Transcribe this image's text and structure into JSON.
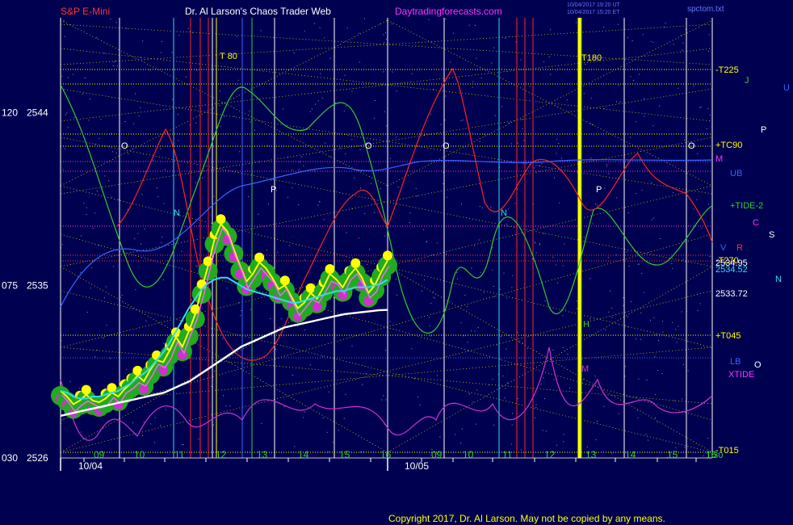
{
  "header": {
    "symbol": "S&P E-Mini",
    "title": "Dr. Al Larson's Chaos Trader Web",
    "site": "Daytradingforecasts.com",
    "timestamp1": "10/04/2017 19:20 UT",
    "timestamp2": "10/04/2017 15:20 ET",
    "file": "spctom.txt"
  },
  "footer": {
    "copyright": "Copyright 2017, Dr. Al Larson. May not be copied by any means."
  },
  "colors": {
    "background": "#000050",
    "grid": "#ffff00",
    "price": "#ffff00",
    "ma_cyan": "#33ddee",
    "ma_white": "#ffffff",
    "tide_green": "#33cc33",
    "red": "#ff2222",
    "magenta": "#cc33cc",
    "label_magenta": "#ff33ff",
    "label_red": "#ff3333"
  },
  "chart_data": {
    "type": "line",
    "ylim": [
      2526,
      2546
    ],
    "y_axis_labels": [
      {
        "left": "120",
        "value": "2544"
      },
      {
        "left": "075",
        "value": "2535"
      },
      {
        "left": "030",
        "value": "2526"
      }
    ],
    "x_hours": {
      "day1": [
        "09",
        "10",
        "11",
        "12",
        "13",
        "14",
        "15",
        "16"
      ],
      "day2": [
        "09",
        "10",
        "11",
        "12",
        "13",
        "14",
        "15",
        "16"
      ]
    },
    "dates": [
      "10/04",
      "10/05"
    ],
    "overflow_label": "1:30",
    "right_labels": [
      {
        "text": "-T225",
        "color": "#ffff00"
      },
      {
        "text": "J",
        "color": "#33cc33"
      },
      {
        "text": "U",
        "color": "#3366ff"
      },
      {
        "text": "P",
        "color": "#ffffff"
      },
      {
        "text": "+TC90",
        "color": "#ffff00"
      },
      {
        "text": "M",
        "color": "#ff33ff"
      },
      {
        "text": "UB",
        "color": "#3366ff"
      },
      {
        "text": "+TIDE-2",
        "color": "#33cc33"
      },
      {
        "text": "C",
        "color": "#ff33ff"
      },
      {
        "text": "S",
        "color": "#ffffff"
      },
      {
        "text": "V",
        "color": "#3366ff"
      },
      {
        "text": "R",
        "color": "#ff3333"
      },
      {
        "text": "-T270",
        "color": "#ffff00"
      },
      {
        "text": "2534.95",
        "color": "#ffffff"
      },
      {
        "text": "2534.52",
        "color": "#33ddee"
      },
      {
        "text": "N",
        "color": "#33ddee"
      },
      {
        "text": "2533.72",
        "color": "#ffffff"
      },
      {
        "text": "+T045",
        "color": "#ffff00"
      },
      {
        "text": "LB",
        "color": "#3366ff"
      },
      {
        "text": "XTIDE",
        "color": "#ff33ff"
      },
      {
        "text": "O",
        "color": "#ffffff"
      },
      {
        "text": "-T015",
        "color": "#ffff00"
      }
    ],
    "chart_labels": [
      {
        "text": "T 80",
        "color": "#ffff00"
      },
      {
        "text": "T180",
        "color": "#ffff00"
      },
      {
        "text": "O",
        "color": "#ffffff"
      },
      {
        "text": "O",
        "color": "#ffffff"
      },
      {
        "text": "O",
        "color": "#ffffff"
      },
      {
        "text": "O",
        "color": "#ffffff"
      },
      {
        "text": "N",
        "color": "#33ddee"
      },
      {
        "text": "N",
        "color": "#33ddee"
      },
      {
        "text": "P",
        "color": "#ffffff"
      },
      {
        "text": "P",
        "color": "#ffffff"
      },
      {
        "text": "H",
        "color": "#33cc33"
      },
      {
        "text": "M",
        "color": "#cc33cc"
      }
    ],
    "series": [
      {
        "role": "price",
        "color": "#ffff00",
        "values": [
          2529.5,
          2529.2,
          2528.8,
          2529.0,
          2529.3,
          2529.0,
          2528.9,
          2529.1,
          2529.4,
          2529.2,
          2529.6,
          2529.9,
          2530.3,
          2530.0,
          2530.6,
          2531.1,
          2531.0,
          2531.6,
          2532.3,
          2531.8,
          2532.6,
          2533.5,
          2534.8,
          2536.0,
          2537.4,
          2538.2,
          2537.8,
          2536.9,
          2536.0,
          2535.2,
          2535.6,
          2536.2,
          2535.9,
          2535.4,
          2534.8,
          2535.0,
          2534.4,
          2533.8,
          2534.1,
          2534.6,
          2534.3,
          2534.9,
          2535.6,
          2535.3,
          2534.9,
          2535.5,
          2535.9,
          2535.4,
          2534.6,
          2535.0,
          2535.7,
          2536.3
        ]
      },
      {
        "role": "moving-average",
        "color": "#33ddee",
        "values": [
          2529.5,
          2529.4,
          2529.2,
          2529.1,
          2529.1,
          2529.2,
          2529.2,
          2529.3,
          2529.4,
          2529.5,
          2529.7,
          2529.9,
          2530.2,
          2530.4,
          2530.7,
          2531.1,
          2531.5,
          2532.0,
          2532.6,
          2533.2,
          2533.8,
          2534.3,
          2534.8,
          2535.1,
          2535.3,
          2535.4,
          2535.4,
          2535.2,
          2535.0,
          2534.8,
          2534.7,
          2534.6,
          2534.5,
          2534.4,
          2534.3,
          2534.2,
          2534.1,
          2534.1,
          2534.2,
          2534.3,
          2534.4,
          2534.5,
          2534.6,
          2534.7,
          2534.7,
          2534.8,
          2534.9,
          2534.9,
          2534.9,
          2535.0,
          2535.1,
          2535.3
        ]
      },
      {
        "role": "moving-average",
        "color": "#ffffff",
        "values": [
          2528.2,
          2528.3,
          2528.4,
          2528.5,
          2528.6,
          2528.7,
          2528.8,
          2528.9,
          2529.0,
          2529.1,
          2529.2,
          2529.3,
          2529.4,
          2529.6,
          2529.8,
          2530.0,
          2530.3,
          2530.6,
          2530.9,
          2531.2,
          2531.5,
          2531.8,
          2532.0,
          2532.2,
          2532.4,
          2532.6,
          2532.8,
          2532.9,
          2533.0,
          2533.1,
          2533.2,
          2533.3,
          2533.4,
          2533.5,
          2533.55,
          2533.6,
          2533.65,
          2533.7,
          2533.72
        ]
      }
    ]
  }
}
